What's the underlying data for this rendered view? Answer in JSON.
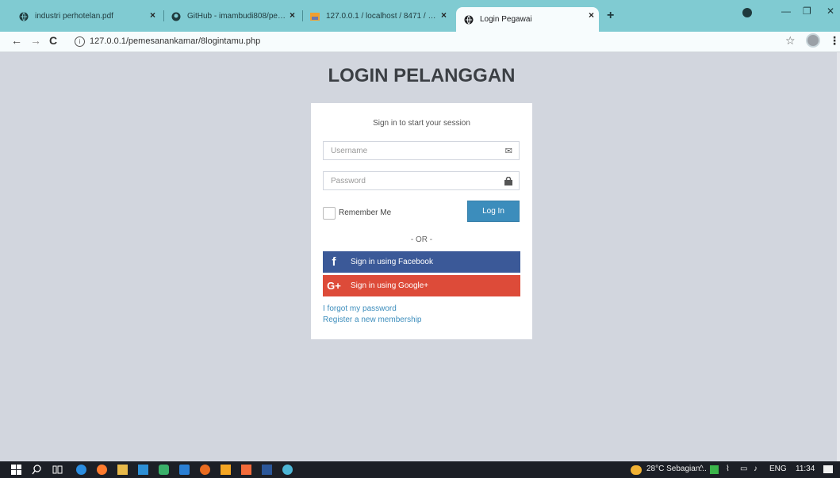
{
  "browser": {
    "tabs": [
      {
        "title": "industri perhotelan.pdf",
        "close": "×"
      },
      {
        "title": "GitHub - imambudi808/pemesanankamar",
        "close": "×"
      },
      {
        "title": "127.0.0.1 / localhost / 8471 / pemesanankamar",
        "close": "×"
      },
      {
        "title": "Login Pegawai",
        "close": "×"
      }
    ],
    "new_tab": "+",
    "url": "127.0.0.1/pemesanankamar/8logintamu.php",
    "window_controls": {
      "minimize": "—",
      "restore": "❐",
      "close": "✕"
    }
  },
  "page": {
    "title": "LOGIN PELANGGAN",
    "box_msg": "Sign in to start your session",
    "username_placeholder": "Username",
    "password_placeholder": "Password",
    "remember_label": "Remember Me",
    "login_button": "Log In",
    "or_text": "- OR -",
    "facebook_button": "Sign in using Facebook",
    "google_button": "Sign in using Google+",
    "forgot_link": "I forgot my password",
    "register_link": "Register a new membership"
  },
  "taskbar": {
    "weather": "28°C  Sebagian...",
    "language": "ENG",
    "time": "11:34"
  },
  "colors": {
    "tab_strip": "#80cbd2",
    "page_bg": "#d2d6de",
    "primary": "#3c8dbc",
    "facebook": "#3b5998",
    "google": "#dd4b39"
  }
}
